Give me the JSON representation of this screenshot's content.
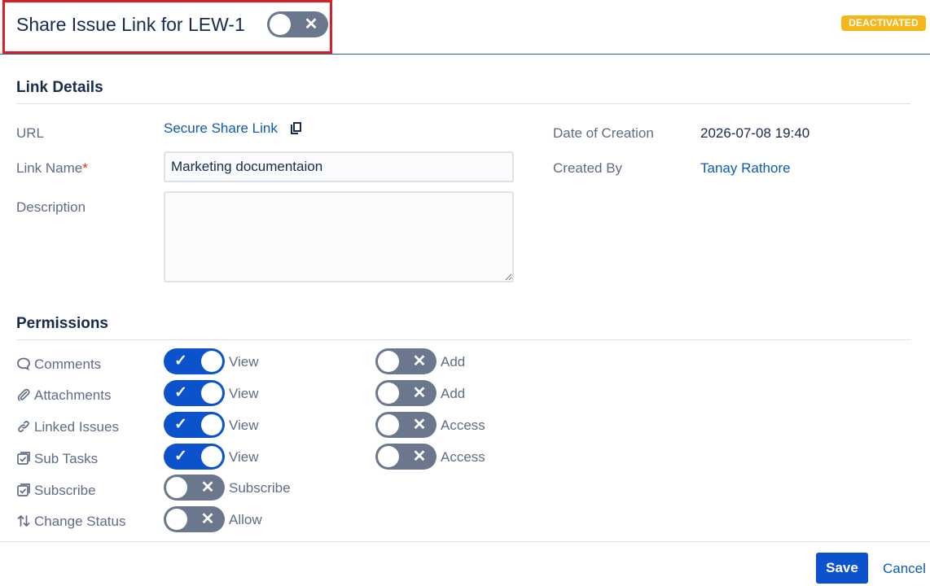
{
  "header": {
    "title": "Share Issue Link for LEW-1",
    "link_active": false,
    "status_badge": "DEACTIVATED"
  },
  "link_details": {
    "section_title": "Link Details",
    "url_label": "URL",
    "url_link_text": "Secure Share Link",
    "copy_icon": "copy-icon",
    "link_name_label": "Link Name",
    "required_mark": "*",
    "link_name_value": "Marketing documentaion",
    "description_label": "Description",
    "description_value": "",
    "date_label": "Date of Creation",
    "date_value": "2026-07-08 19:40",
    "created_by_label": "Created By",
    "created_by_value": "Tanay Rathore"
  },
  "permissions": {
    "section_title": "Permissions",
    "rows": [
      {
        "label": "Comments",
        "icon": "comment-icon",
        "primary": {
          "label": "View",
          "on": true
        },
        "secondary": {
          "label": "Add",
          "on": false
        }
      },
      {
        "label": "Attachments",
        "icon": "paperclip-icon",
        "primary": {
          "label": "View",
          "on": true
        },
        "secondary": {
          "label": "Add",
          "on": false
        }
      },
      {
        "label": "Linked Issues",
        "icon": "link-icon",
        "primary": {
          "label": "View",
          "on": true
        },
        "secondary": {
          "label": "Access",
          "on": false
        }
      },
      {
        "label": "Sub Tasks",
        "icon": "subtask-icon",
        "primary": {
          "label": "View",
          "on": true
        },
        "secondary": {
          "label": "Access",
          "on": false
        }
      },
      {
        "label": "Subscribe",
        "icon": "subscribe-icon",
        "primary": {
          "label": "Subscribe",
          "on": false
        }
      },
      {
        "label": "Change Status",
        "icon": "transition-arrows-icon",
        "primary": {
          "label": "Allow",
          "on": false
        }
      }
    ]
  },
  "footer": {
    "save_label": "Save",
    "cancel_label": "Cancel"
  },
  "colors": {
    "accent": "#0b52cc",
    "toggle_off": "#6b778c",
    "badge": "#f5b617",
    "highlight_box": "#d6202b",
    "link": "#0c5ab2"
  }
}
